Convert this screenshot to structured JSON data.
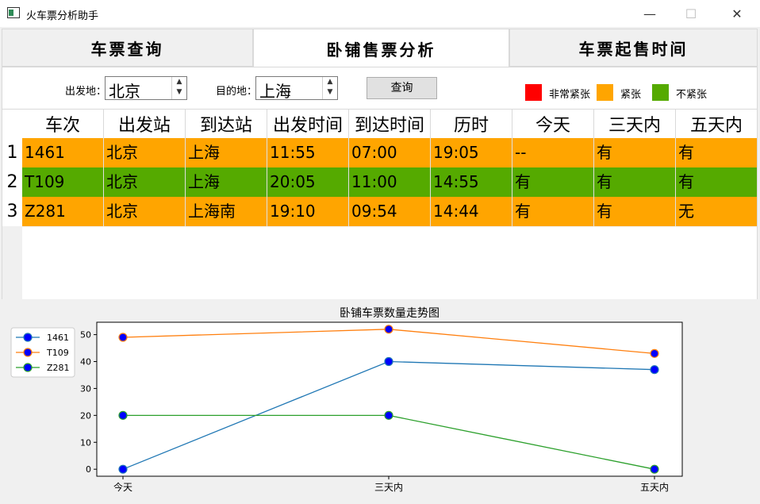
{
  "window": {
    "title": "火车票分析助手",
    "minimize": "—",
    "maximize": "☐",
    "close": "✕"
  },
  "tabs": [
    {
      "label": "车票查询",
      "active": false
    },
    {
      "label": "卧铺售票分析",
      "active": true
    },
    {
      "label": "车票起售时间",
      "active": false
    }
  ],
  "query": {
    "from_label": "出发地：",
    "from_value": "北京",
    "to_label": "目的地：",
    "to_value": "上海",
    "button": "查询"
  },
  "legend": [
    {
      "label": "非常紧张",
      "color": "#ff0000"
    },
    {
      "label": "紧张",
      "color": "#ffa500"
    },
    {
      "label": "不紧张",
      "color": "#55aa00"
    }
  ],
  "table": {
    "headers": [
      "车次",
      "出发站",
      "到达站",
      "出发时间",
      "到达时间",
      "历时",
      "今天",
      "三天内",
      "五天内"
    ],
    "rows": [
      {
        "num": "1",
        "color": "#ffa500",
        "cells": [
          "1461",
          "北京",
          "上海",
          "11:55",
          "07:00",
          "19:05",
          "--",
          "有",
          "有"
        ]
      },
      {
        "num": "2",
        "color": "#55aa00",
        "cells": [
          "T109",
          "北京",
          "上海",
          "20:05",
          "11:00",
          "14:55",
          "有",
          "有",
          "有"
        ]
      },
      {
        "num": "3",
        "color": "#ffa500",
        "cells": [
          "Z281",
          "北京",
          "上海南",
          "19:10",
          "09:54",
          "14:44",
          "有",
          "有",
          "无"
        ]
      }
    ]
  },
  "chart_data": {
    "type": "line",
    "title": "卧铺车票数量走势图",
    "categories": [
      "今天",
      "三天内",
      "五天内"
    ],
    "series": [
      {
        "name": "1461",
        "values": [
          0,
          40,
          37
        ],
        "color": "#1f77b4"
      },
      {
        "name": "T109",
        "values": [
          49,
          52,
          43
        ],
        "color": "#ff7f0e"
      },
      {
        "name": "Z281",
        "values": [
          20,
          20,
          0
        ],
        "color": "#2ca02c"
      }
    ],
    "marker_color": "#0000ff",
    "yticks": [
      0,
      10,
      20,
      30,
      40,
      50
    ],
    "ylim": [
      -2.6,
      54.6
    ],
    "legend": "upper-left",
    "grid": false
  }
}
